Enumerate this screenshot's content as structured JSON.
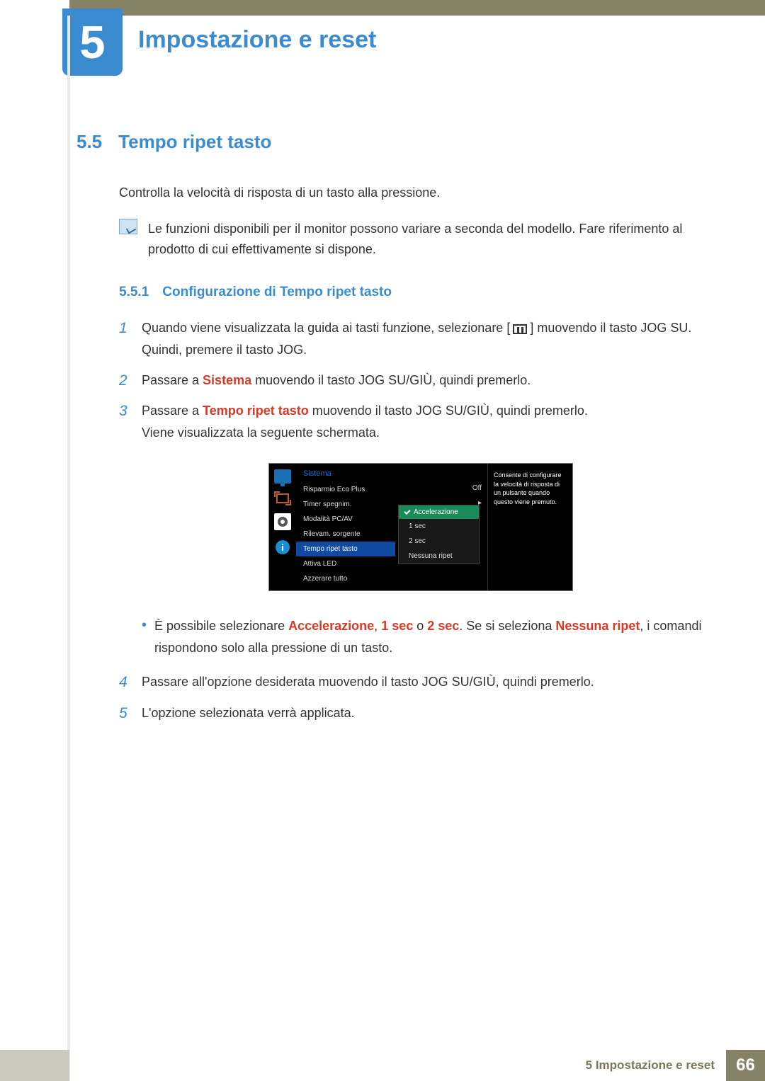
{
  "chapter": {
    "number": "5",
    "title": "Impostazione e reset"
  },
  "section": {
    "number": "5.5",
    "title": "Tempo ripet tasto"
  },
  "intro_para": "Controlla la velocità di risposta di un tasto alla pressione.",
  "note_text": "Le funzioni disponibili per il monitor possono variare a seconda del modello. Fare riferimento al prodotto di cui effettivamente si dispone.",
  "subsection": {
    "number": "5.5.1",
    "title": "Configurazione di Tempo ripet tasto"
  },
  "steps": {
    "s1a": "Quando viene visualizzata la guida ai tasti funzione, selezionare [",
    "s1b": "] muovendo il tasto JOG SU. Quindi, premere il tasto JOG.",
    "s2_prefix": "Passare a ",
    "s2_bold": "Sistema",
    "s2_suffix": " muovendo il tasto JOG SU/GIÙ, quindi premerlo.",
    "s3_prefix": "Passare a ",
    "s3_bold": "Tempo ripet tasto",
    "s3_suffix": " muovendo il tasto JOG SU/GIÙ, quindi premerlo.",
    "s3_line2": "Viene visualizzata la seguente schermata.",
    "bullet_prefix": "È possibile selezionare ",
    "bullet_b1": "Accelerazione",
    "bullet_c1": ", ",
    "bullet_b2": "1 sec",
    "bullet_c2": " o ",
    "bullet_b3": "2 sec",
    "bullet_c3": ". Se si seleziona ",
    "bullet_b4": "Nessuna ripet",
    "bullet_suffix": ", i comandi rispondono solo alla pressione di un tasto.",
    "s4": "Passare all'opzione desiderata muovendo il tasto JOG SU/GIÙ, quindi premerlo.",
    "s5": "L'opzione selezionata verrà applicata."
  },
  "step_numbers": {
    "n1": "1",
    "n2": "2",
    "n3": "3",
    "n4": "4",
    "n5": "5"
  },
  "osd": {
    "menu_title": "Sistema",
    "items": {
      "eco": "Risparmio Eco Plus",
      "timer": "Timer spegnim.",
      "pcav": "Modalità PC/AV",
      "source": "Rilevam. sorgente",
      "repeat": "Tempo ripet tasto",
      "led": "Attiva LED",
      "reset": "Azzerare tutto"
    },
    "value_off": "Off",
    "value_arrow": "▸",
    "dropdown": {
      "accel": "Accelerazione",
      "opt1": "1 sec",
      "opt2": "2 sec",
      "opt3": "Nessuna ripet"
    },
    "help_text": "Consente di configurare la velocità di risposta di un pulsante quando questo viene premuto."
  },
  "footer": {
    "text": "5 Impostazione e reset",
    "page": "66"
  }
}
